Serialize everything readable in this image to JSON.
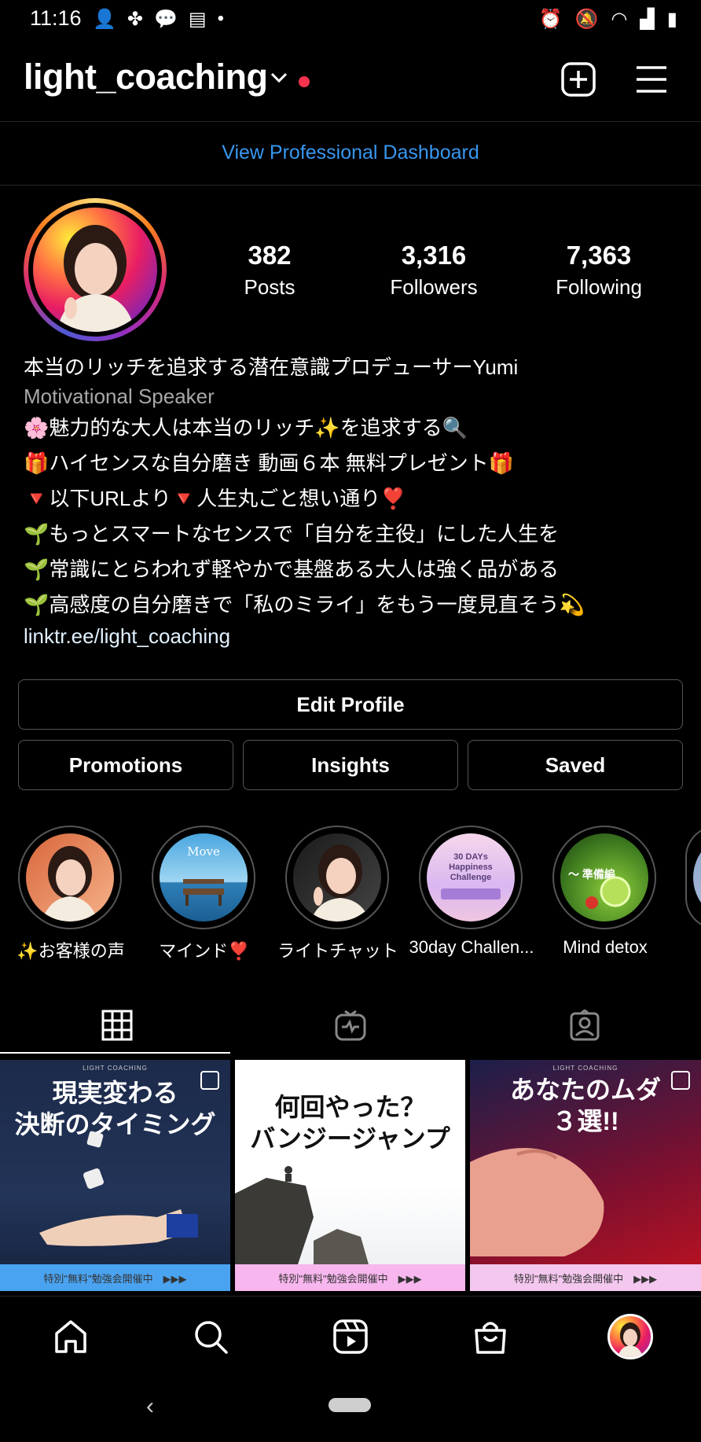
{
  "status": {
    "time": "11:16"
  },
  "header": {
    "username": "light_coaching"
  },
  "dashboard_link": "View Professional Dashboard",
  "stats": [
    {
      "value": "382",
      "label": "Posts"
    },
    {
      "value": "3,316",
      "label": "Followers"
    },
    {
      "value": "7,363",
      "label": "Following"
    }
  ],
  "bio": {
    "name": "本当のリッチを追求する潜在意識プロデューサーYumi",
    "category": "Motivational Speaker",
    "lines": [
      "🌸魅力的な大人は本当のリッチ✨を追求する🔍",
      "🎁ハイセンスな自分磨き 動画６本 無料プレゼント🎁",
      "🔻以下URLより🔻人生丸ごと想い通り❣️",
      "🌱もっとスマートなセンスで「自分を主役」にした人生を",
      "🌱常識にとらわれず軽やかで基盤ある大人は強く品がある",
      "🌱高感度の自分磨きで「私のミライ」をもう一度見直そう💫"
    ],
    "link": "linktr.ee/light_coaching"
  },
  "buttons": {
    "edit_profile": "Edit Profile",
    "promotions": "Promotions",
    "insights": "Insights",
    "saved": "Saved"
  },
  "highlights": [
    {
      "label": "✨お客様の声"
    },
    {
      "label": "マインド❣️",
      "image_text": "Move"
    },
    {
      "label": "ライトチャット"
    },
    {
      "label": "30day Challen...",
      "image_text": "30 DAYs Happiness Challenge"
    },
    {
      "label": "Mind detox",
      "image_text": "〜 準備編"
    }
  ],
  "posts": [
    {
      "header": "LIGHT COACHING",
      "text": "現実変わる\n決断のタイミング",
      "footer": "特別\"無料\"勉強会開催中　▶▶▶"
    },
    {
      "header": "",
      "text": "何回やった？\nバンジージャンプ",
      "footer": "特別\"無料\"勉強会開催中　▶▶▶"
    },
    {
      "header": "LIGHT COACHING",
      "text": "あなたのムダ\n３選!!",
      "footer": "特別\"無料\"勉強会開催中　▶▶▶"
    }
  ],
  "icons": {
    "new_post": "plus-square-icon",
    "menu": "hamburger-menu-icon",
    "grid": "grid-icon",
    "igtv": "igtv-icon",
    "tagged": "tagged-person-icon",
    "home": "home-icon",
    "search": "search-icon",
    "reels": "reels-icon",
    "shop": "shopping-bag-icon"
  },
  "colors": {
    "link": "#3897f0",
    "notification_dot": "#f5334e",
    "background": "#000000"
  }
}
